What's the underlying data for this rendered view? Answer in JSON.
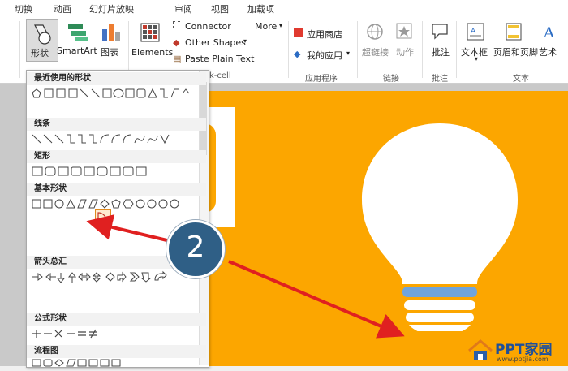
{
  "tabs": [
    "切换",
    "动画",
    "幻灯片放映",
    "审阅",
    "视图",
    "加载项"
  ],
  "ribbon": {
    "shapes_label": "形状",
    "smartart_label": "SmartArt",
    "chart_label": "图表",
    "elements_label": "Elements",
    "connector_label": "Connector",
    "other_shapes_label": "Other Shapes",
    "paste_plain_label": "Paste Plain Text",
    "more_label": "More",
    "group_cell_label": "k-cell",
    "app_store_label": "应用商店",
    "my_apps_label": "我的应用",
    "apps_group_label": "应用程序",
    "hyperlink_label": "超链接",
    "action_label": "动作",
    "links_group_label": "链接",
    "comment_label": "批注",
    "comment_group_label": "批注",
    "textbox_label": "文本框",
    "header_footer_label": "页眉和页脚",
    "wordart_label": "艺术",
    "text_group_label": "文本"
  },
  "dropdown": {
    "sections": [
      "最近使用的形状",
      "线条",
      "矩形",
      "基本形状",
      "箭头总汇",
      "公式形状",
      "流程图"
    ]
  },
  "callout_number": "2",
  "watermark": {
    "brand": "PPT家园",
    "url": "www.pptjia.com"
  },
  "colors": {
    "slide": "#fca600",
    "callout": "#2f5f86",
    "arrow": "#e02020",
    "bulb_band": "#6fa4dc"
  }
}
